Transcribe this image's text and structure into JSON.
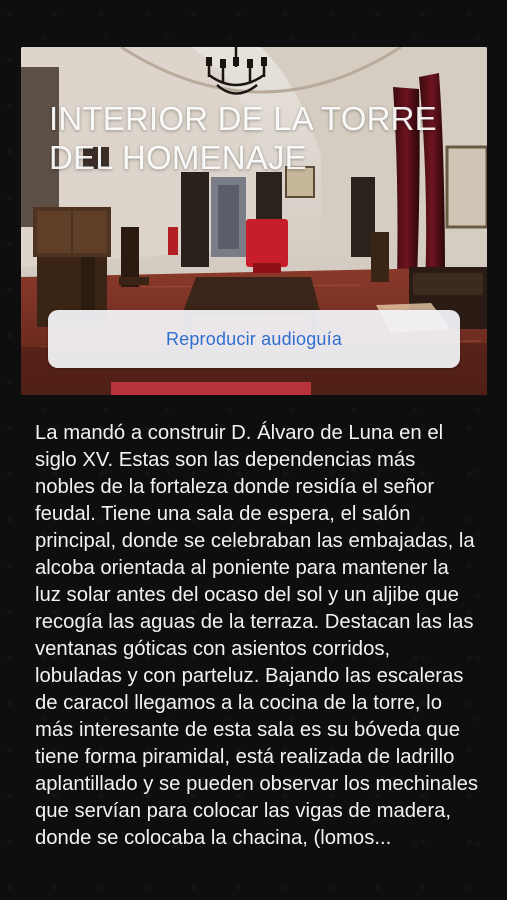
{
  "hero": {
    "title": "INTERIOR DE LA TORRE DEL HOMENAJE",
    "image_icon": "castle-hall-photo"
  },
  "audio_button": {
    "label": "Reproducir audioguía",
    "color": "#2f6fd0"
  },
  "description": "La mandó a construir D. Álvaro de Luna en el siglo XV. Estas son las dependencias más nobles de la fortaleza donde residía el señor feudal. Tiene una sala de espera, el salón principal, donde se celebraban las embajadas, la alcoba orientada al poniente para mantener la luz solar antes del ocaso del sol y un aljibe que recogía las aguas de la terraza. Destacan las las ventanas góticas con asientos corridos, lobuladas y con parteluz. Bajando las escaleras de caracol llegamos a la cocina de la torre, lo más interesante de esta sala es su bóveda que tiene forma piramidal, está realizada de ladrillo aplantillado y se pueden observar los mechinales que servían para colocar las vigas de madera, donde se colocaba la chacina, (lomos..."
}
